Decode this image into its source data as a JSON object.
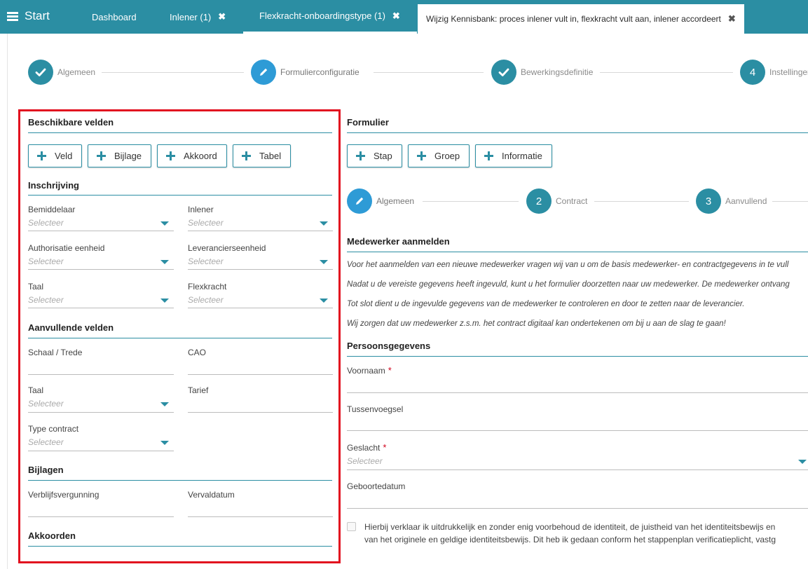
{
  "topbar": {
    "start_label": "Start",
    "tabs": [
      {
        "label": "Dashboard"
      },
      {
        "label": "Inlener (1)"
      },
      {
        "label": "Flexkracht-onboardingstype (1)"
      },
      {
        "label": "Wijzig Kennisbank: proces inlener vult in, flexkracht vult aan, inlener accordeert"
      }
    ],
    "close_glyph": "✖"
  },
  "wizard": {
    "steps": [
      {
        "label": "Algemeen",
        "state": "done"
      },
      {
        "label": "Formulierconfiguratie",
        "state": "active"
      },
      {
        "label": "Bewerkingsdefinitie",
        "state": "done"
      },
      {
        "number": "4",
        "label": "Instellingen"
      }
    ]
  },
  "left": {
    "title": "Beschikbare velden",
    "buttons": [
      "Veld",
      "Bijlage",
      "Akkoord",
      "Tabel"
    ],
    "inschrijving": {
      "title": "Inschrijving",
      "fields": [
        {
          "label": "Bemiddelaar",
          "value": "Selecteer"
        },
        {
          "label": "Inlener",
          "value": "Selecteer"
        },
        {
          "label": "Authorisatie eenheid",
          "value": "Selecteer"
        },
        {
          "label": "Leverancierseenheid",
          "value": "Selecteer"
        },
        {
          "label": "Taal",
          "value": "Selecteer"
        },
        {
          "label": "Flexkracht",
          "value": "Selecteer"
        }
      ]
    },
    "aanvullend": {
      "title": "Aanvullende velden",
      "fields": [
        {
          "label": "Schaal / Trede"
        },
        {
          "label": "CAO"
        },
        {
          "label": "Taal",
          "value": "Selecteer"
        },
        {
          "label": "Tarief"
        },
        {
          "label": "Type contract",
          "value": "Selecteer"
        }
      ]
    },
    "bijlagen": {
      "title": "Bijlagen",
      "fields": [
        {
          "label": "Verblijfsvergunning"
        },
        {
          "label": "Vervaldatum"
        }
      ]
    },
    "akkoorden": {
      "title": "Akkoorden"
    }
  },
  "right": {
    "title": "Formulier",
    "buttons": [
      "Stap",
      "Groep",
      "Informatie"
    ],
    "steps": [
      {
        "label": "Algemeen"
      },
      {
        "number": "2",
        "label": "Contract"
      },
      {
        "number": "3",
        "label": "Aanvullend"
      }
    ],
    "medewerker_title": "Medewerker aanmelden",
    "info_lines": [
      "Voor het aanmelden van een nieuwe medewerker vragen wij van u om de basis medewerker- en contractgegevens in te vull",
      "Nadat u de vereiste gegevens heeft ingevuld, kunt u het formulier doorzetten naar uw medewerker. De medewerker ontvang",
      "Tot slot dient u de ingevulde gegevens van de medewerker te controleren en door te zetten naar de leverancier.",
      "Wij zorgen dat uw medewerker z.s.m. het contract digitaal kan ondertekenen om bij u aan de slag te gaan!"
    ],
    "persoons_title": "Persoonsgegevens",
    "fields": [
      {
        "label": "Voornaam",
        "required": "*"
      },
      {
        "label": "Tussenvoegsel"
      },
      {
        "label": "Geslacht",
        "required": "*",
        "value": "Selecteer"
      },
      {
        "label": "Geboortedatum"
      }
    ],
    "checkbox_lines": [
      "Hierbij verklaar ik uitdrukkelijk en zonder enig voorbehoud de identiteit, de juistheid van het identiteitsbewijs en",
      "van het originele en geldige identiteitsbewijs. Dit heb ik gedaan conform het stappenplan verificatieplicht, vastg"
    ]
  },
  "colors": {
    "teal": "#2b8ea3",
    "blue": "#2e9bd6",
    "highlight": "#e2101f"
  }
}
